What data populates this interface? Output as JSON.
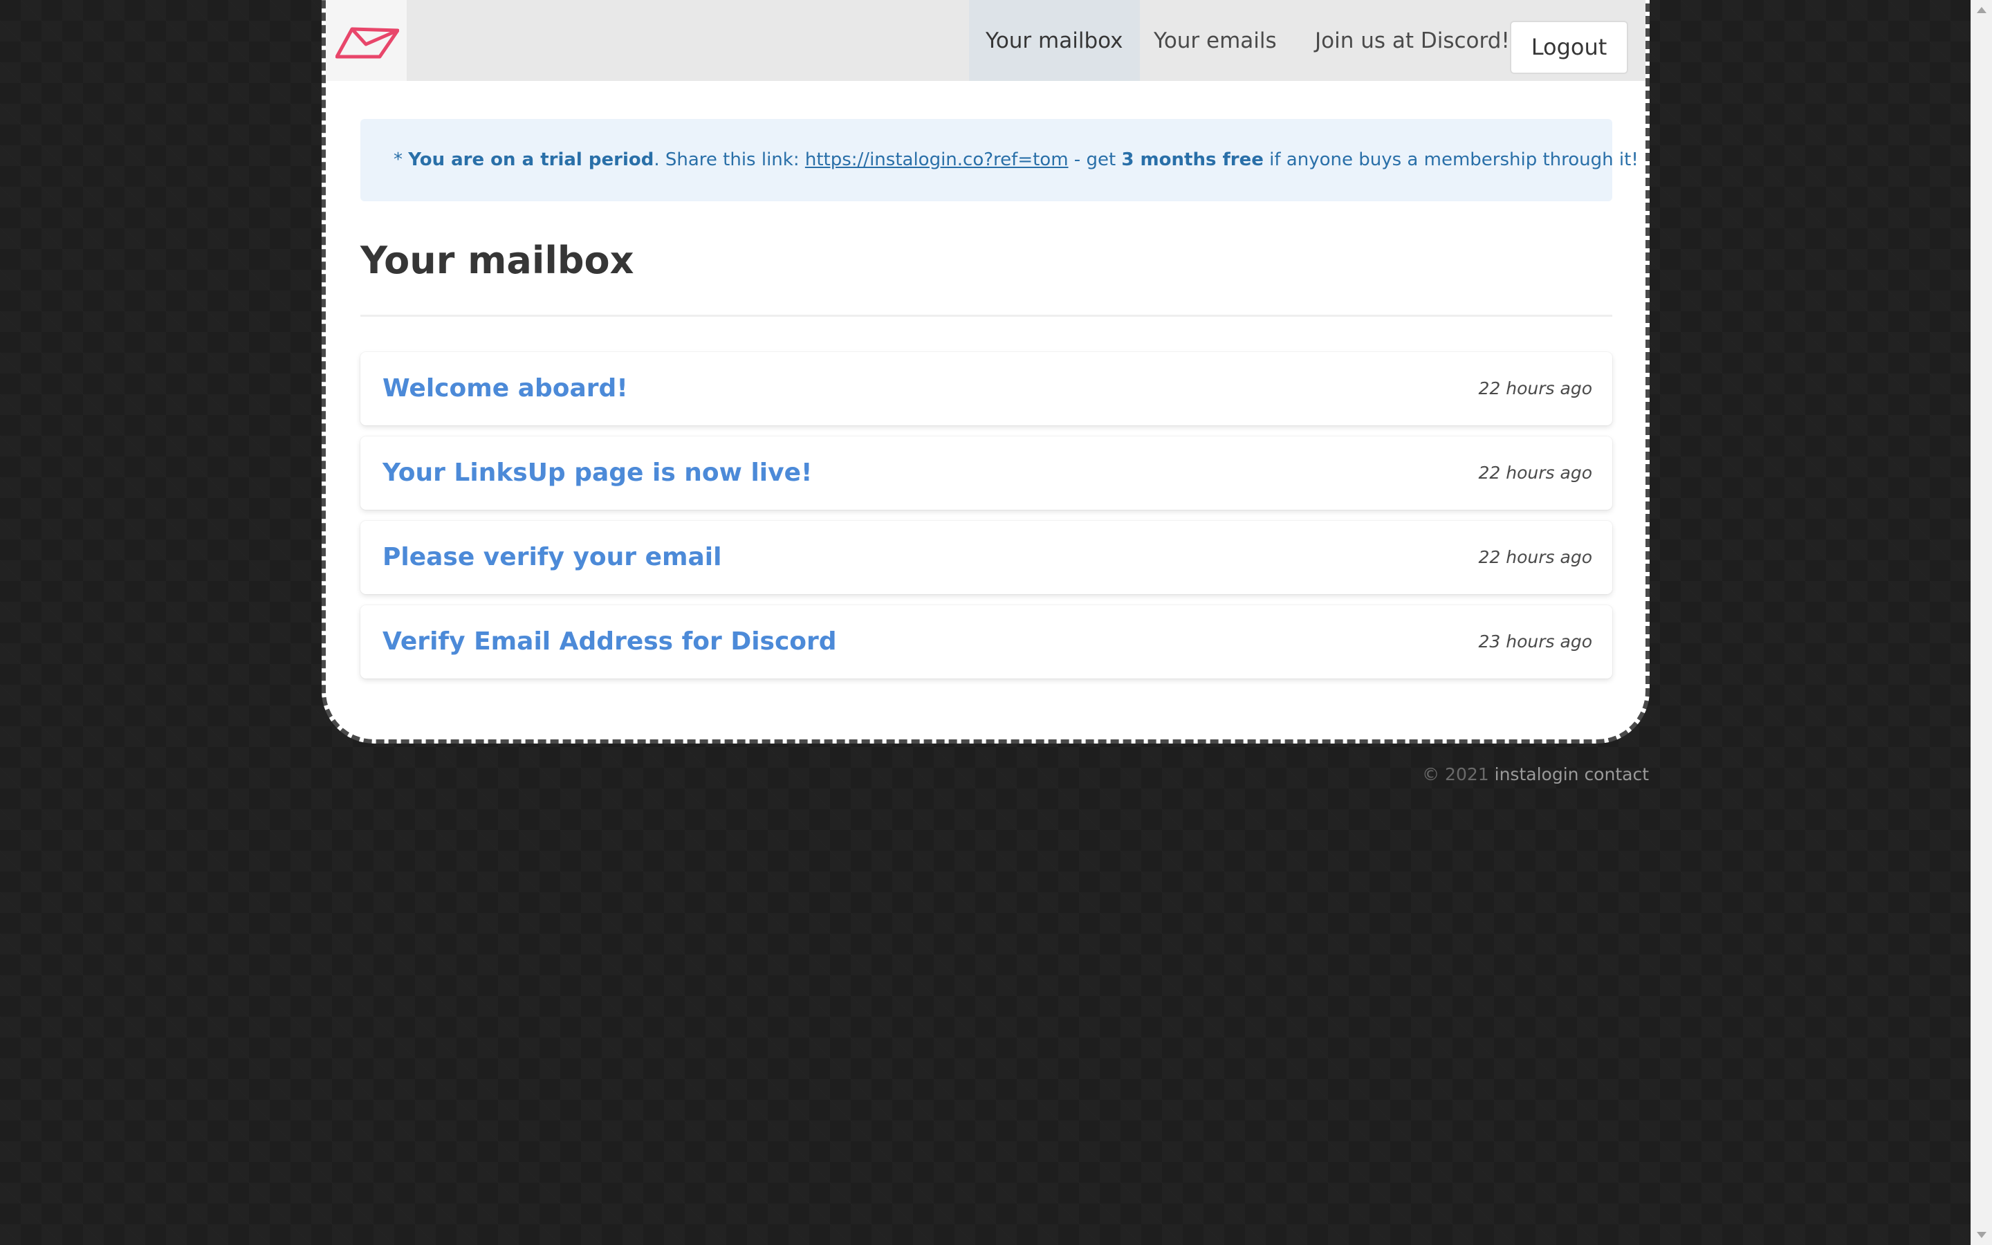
{
  "nav": {
    "logo": "envelope-logo",
    "links": [
      {
        "label": "Your mailbox",
        "active": true
      },
      {
        "label": "Your emails",
        "active": false
      },
      {
        "label": "Join us at Discord!",
        "active": false
      }
    ],
    "logout_label": "Logout"
  },
  "notice": {
    "prefix": "* ",
    "trial_text": "You are on a trial period",
    "share_text": ". Share this link: ",
    "ref_link": "https://instalogin.co?ref=tom",
    "get_text": " - get ",
    "free_text": "3 months free",
    "suffix_text": " if anyone buys a membership through it!"
  },
  "page_title": "Your mailbox",
  "emails": [
    {
      "subject": "Welcome aboard!",
      "time": "22 hours ago"
    },
    {
      "subject": "Your LinksUp page is now live!",
      "time": "22 hours ago"
    },
    {
      "subject": "Please verify your email",
      "time": "22 hours ago"
    },
    {
      "subject": "Verify Email Address for Discord",
      "time": "23 hours ago"
    }
  ],
  "footer": {
    "copyright": "© 2021",
    "brand_link": "instalogin",
    "contact_link": "contact"
  },
  "colors": {
    "logo": "#e8466a",
    "link_blue": "#4c8ad8",
    "notice_bg": "#ebf3fb",
    "notice_text": "#296fa8",
    "page_bg": "#1e1e1e"
  }
}
